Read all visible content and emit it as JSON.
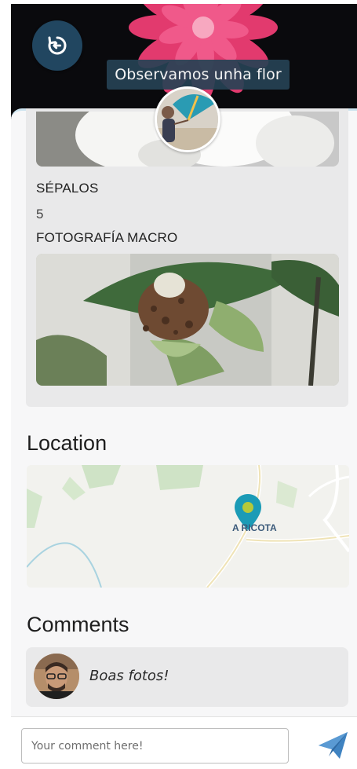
{
  "header": {
    "title": "Observamos unha flor",
    "back_icon": "back-arrow-icon",
    "flower_color": "#d6245c"
  },
  "details": {
    "sepals_label": "SÉPALOS",
    "sepals_value": "5",
    "macro_label": "FOTOGRAFÍA MACRO"
  },
  "location": {
    "title": "Location",
    "place_label": "A RICOTA",
    "marker_color": "#1b9bb6"
  },
  "comments": {
    "title": "Comments",
    "items": [
      {
        "text": "Boas fotos!"
      }
    ]
  },
  "composer": {
    "placeholder": "Your comment here!",
    "send_icon": "paper-plane-icon",
    "send_color": "#3f83c1"
  }
}
